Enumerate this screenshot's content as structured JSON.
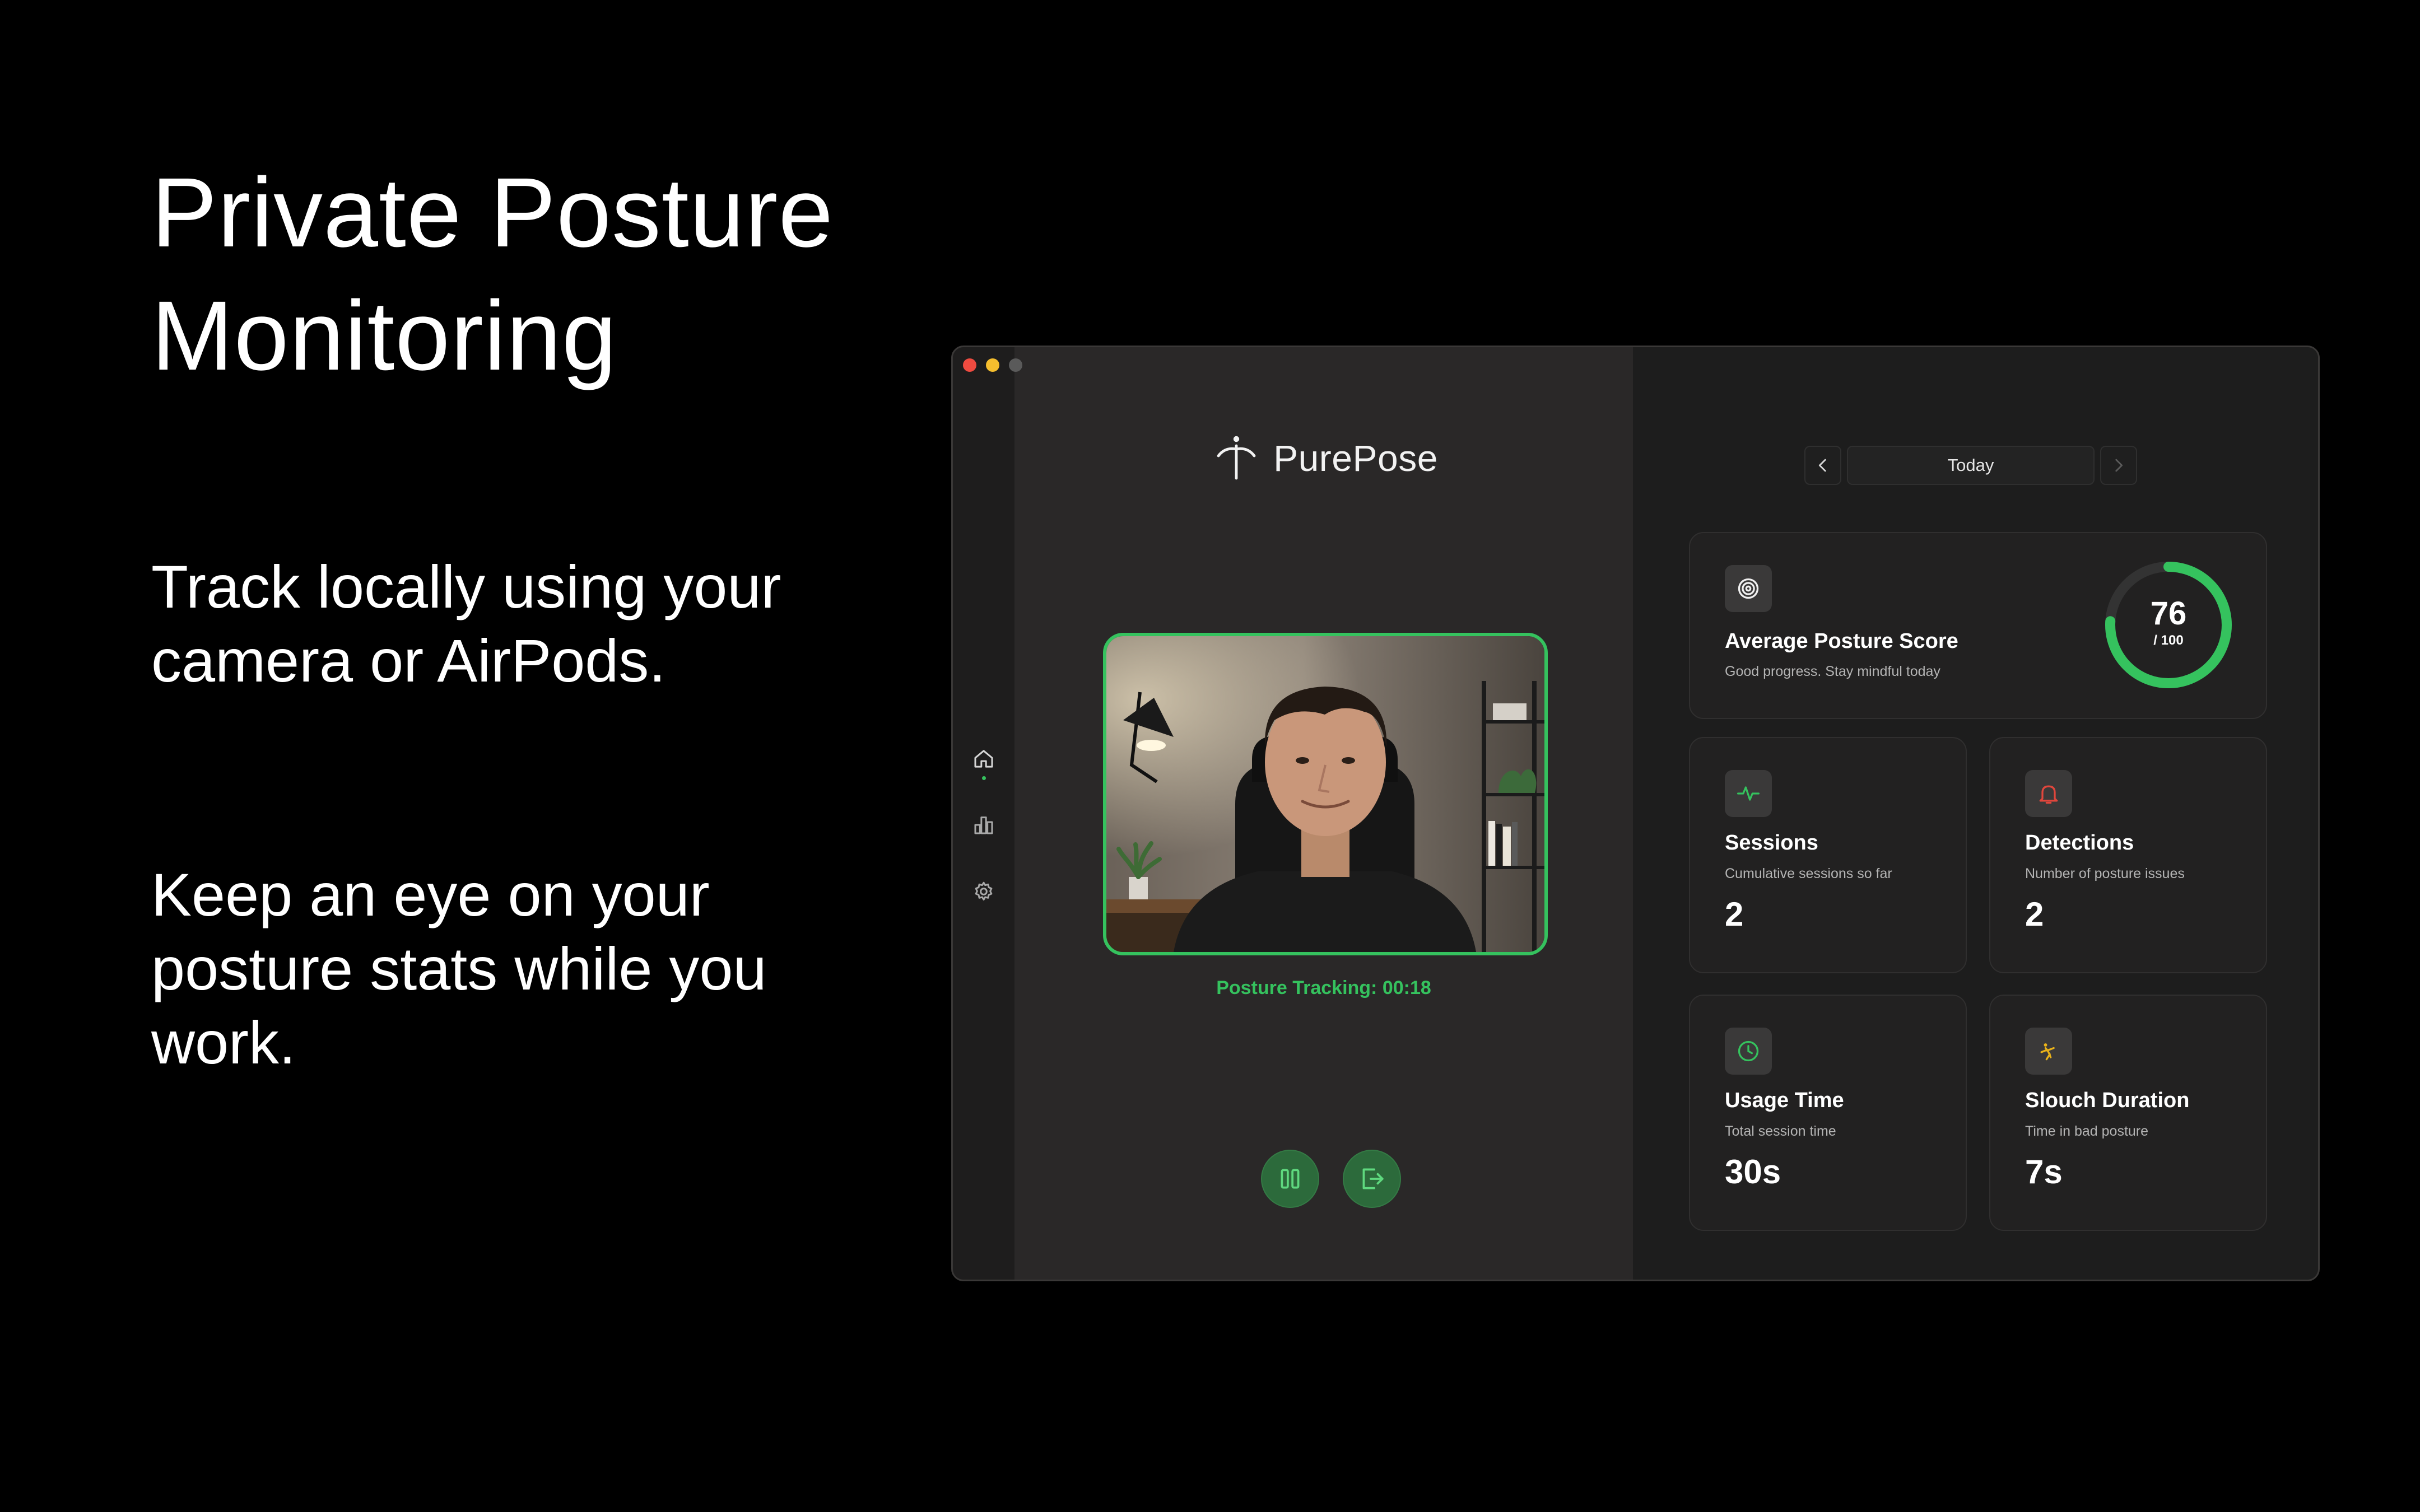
{
  "marketing": {
    "headline": "Private Posture Monitoring",
    "tagline_1": "Track locally using your camera or AirPods.",
    "tagline_2": "Keep an eye on your posture stats while you work."
  },
  "app": {
    "name": "PurePose",
    "sidebar": {
      "items": [
        {
          "name": "home",
          "icon": "home-icon",
          "active": true
        },
        {
          "name": "stats",
          "icon": "bar-chart-icon",
          "active": false
        },
        {
          "name": "settings",
          "icon": "gear-icon",
          "active": false
        }
      ]
    },
    "camera": {
      "status": "Posture Tracking: 00:18"
    },
    "controls": {
      "pause_icon": "pause-icon",
      "exit_icon": "exit-icon"
    },
    "date_nav": {
      "label": "Today",
      "prev_icon": "chevron-left-icon",
      "next_icon": "chevron-right-icon"
    },
    "score_card": {
      "title": "Average Posture Score",
      "subtitle": "Good progress. Stay mindful today",
      "value": "76",
      "denominator": "/ 100",
      "score_fraction": 0.76,
      "icon": "target-icon"
    },
    "stats": [
      {
        "key": "sessions",
        "title": "Sessions",
        "subtitle": "Cumulative sessions so far",
        "value": "2",
        "icon": "pulse-icon",
        "icon_color": "#35c25e"
      },
      {
        "key": "detections",
        "title": "Detections",
        "subtitle": "Number of posture issues",
        "value": "2",
        "icon": "bell-icon",
        "icon_color": "#e0463c"
      },
      {
        "key": "usage",
        "title": "Usage Time",
        "subtitle": "Total session time",
        "value": "30s",
        "icon": "clock-icon",
        "icon_color": "#35c25e"
      },
      {
        "key": "slouch",
        "title": "Slouch Duration",
        "subtitle": "Time in bad posture",
        "value": "7s",
        "icon": "slouch-icon",
        "icon_color": "#e9b21a"
      }
    ],
    "colors": {
      "accent_green": "#35c25e",
      "background": "#000000",
      "traffic_red": "#ef4b40",
      "traffic_yellow": "#f5be2e",
      "traffic_gray": "#5a5a5a"
    }
  }
}
